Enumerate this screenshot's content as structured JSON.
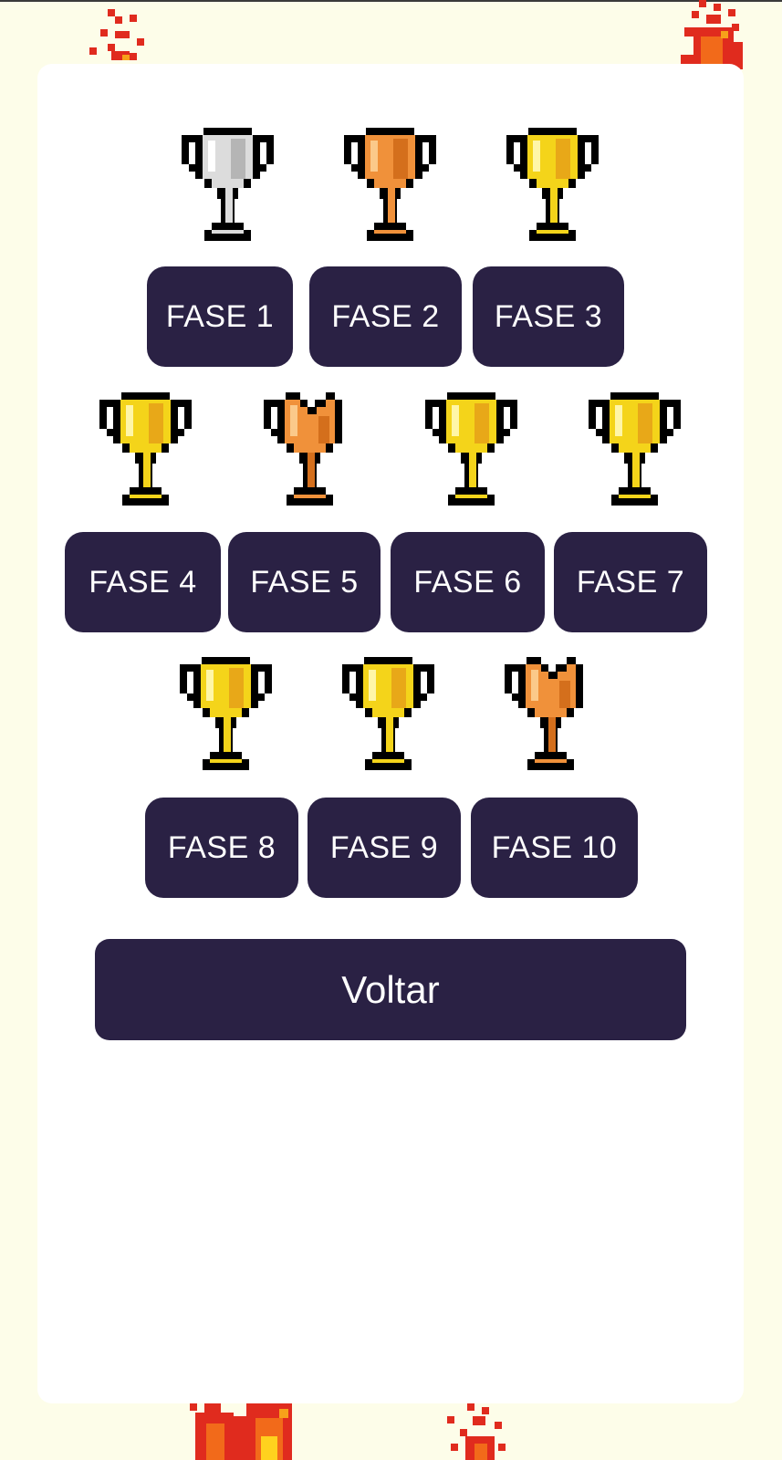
{
  "colors": {
    "background": "#fdfde9",
    "card": "#ffffff",
    "button": "#2a2144",
    "button_text": "#ffffff"
  },
  "phases": [
    {
      "label": "FASE 1",
      "trophy": "silver-trophy-icon"
    },
    {
      "label": "FASE 2",
      "trophy": "bronze-trophy-icon"
    },
    {
      "label": "FASE 3",
      "trophy": "gold-trophy-icon"
    },
    {
      "label": "FASE 4",
      "trophy": "gold-trophy-icon"
    },
    {
      "label": "FASE 5",
      "trophy": "broken-bronze-trophy-icon"
    },
    {
      "label": "FASE 6",
      "trophy": "gold-trophy-icon"
    },
    {
      "label": "FASE 7",
      "trophy": "gold-trophy-icon"
    },
    {
      "label": "FASE 8",
      "trophy": "gold-trophy-icon"
    },
    {
      "label": "FASE 9",
      "trophy": "gold-trophy-icon"
    },
    {
      "label": "FASE 10",
      "trophy": "broken-bronze-trophy-icon"
    }
  ],
  "back_label": "Voltar"
}
